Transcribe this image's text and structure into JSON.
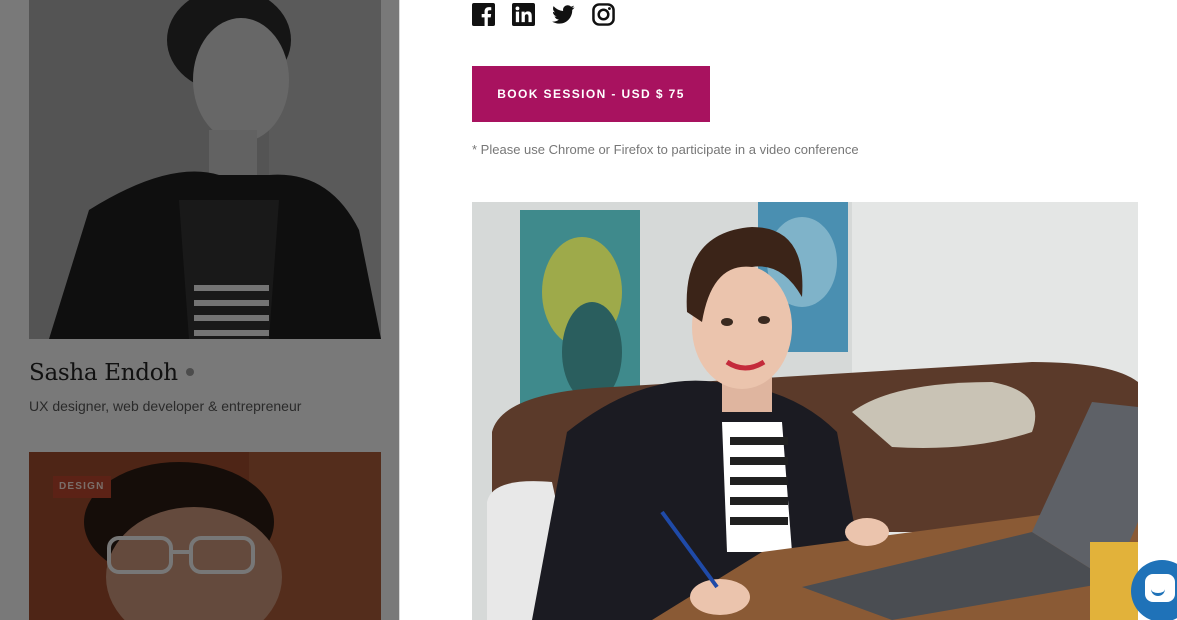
{
  "mentor": {
    "name": "Sasha Endoh",
    "title": "UX designer, web developer & entrepreneur"
  },
  "next_card": {
    "category": "DESIGN"
  },
  "social": [
    {
      "icon": "facebook-icon"
    },
    {
      "icon": "linkedin-icon"
    },
    {
      "icon": "twitter-icon"
    },
    {
      "icon": "instagram-icon"
    }
  ],
  "booking": {
    "button_label": "BOOK SESSION - USD $ 75",
    "note": "* Please use Chrome or Firefox to participate in a video conference"
  },
  "colors": {
    "accent": "#a8125f",
    "chat": "#1f72b8"
  }
}
